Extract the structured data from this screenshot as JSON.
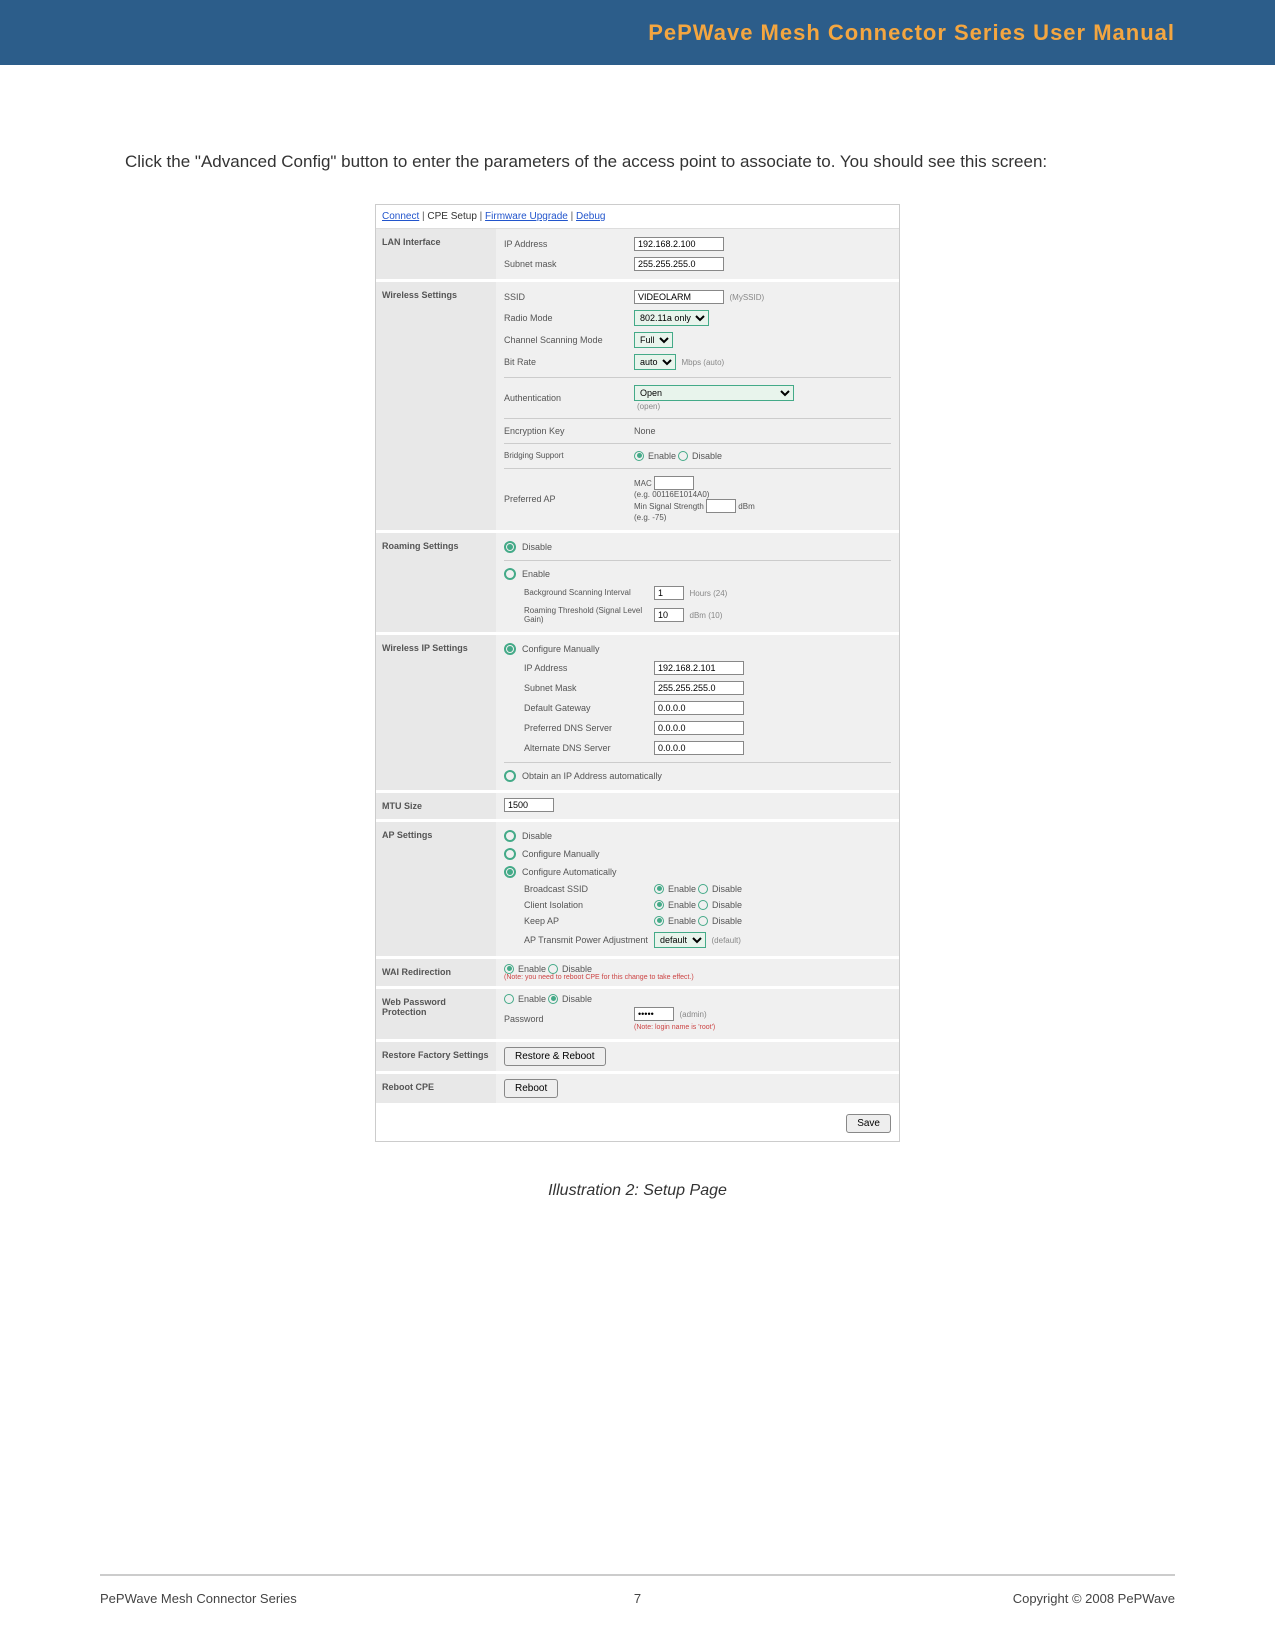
{
  "header": {
    "title": "PePWave Mesh Connector Series User Manual"
  },
  "intro": "Click the \"Advanced Config\" button to enter the parameters of the access point to associate to.  You should see this screen:",
  "nav": {
    "connect": "Connect",
    "cpe": "CPE Setup",
    "firmware": "Firmware Upgrade",
    "debug": "Debug"
  },
  "lan": {
    "title": "LAN Interface",
    "ip_label": "IP Address",
    "ip": "192.168.2.100",
    "mask_label": "Subnet mask",
    "mask": "255.255.255.0"
  },
  "wireless": {
    "title": "Wireless Settings",
    "ssid_label": "SSID",
    "ssid": "VIDEOLARM",
    "ssid_note": "(MySSID)",
    "radio_label": "Radio Mode",
    "radio": "802.11a only",
    "scan_label": "Channel Scanning Mode",
    "scan": "Full",
    "bitrate_label": "Bit Rate",
    "bitrate": "auto",
    "bitrate_note": "Mbps (auto)",
    "auth_label": "Authentication",
    "auth": "Open",
    "auth_note": "(open)",
    "enc_label": "Encryption Key",
    "enc": "None",
    "bridge_label": "Bridging Support",
    "enable": "Enable",
    "disable": "Disable",
    "pref_label": "Preferred AP",
    "mac": "MAC",
    "mac_eg": "(e.g. 00116E1014A0)",
    "min_sig": "Min Signal Strength",
    "dbm": "dBm",
    "dbm_eg": "(e.g. -75)"
  },
  "roaming": {
    "title": "Roaming Settings",
    "disable": "Disable",
    "enable": "Enable",
    "bg_label": "Background Scanning Interval",
    "bg_val": "1",
    "bg_note": "Hours (24)",
    "thr_label": "Roaming Threshold (Signal Level Gain)",
    "thr_val": "10",
    "thr_note": "dBm (10)"
  },
  "wip": {
    "title": "Wireless IP Settings",
    "configure": "Configure Manually",
    "ip_label": "IP Address",
    "ip": "192.168.2.101",
    "mask_label": "Subnet Mask",
    "mask": "255.255.255.0",
    "gw_label": "Default Gateway",
    "gw": "0.0.0.0",
    "dns1_label": "Preferred DNS Server",
    "dns1": "0.0.0.0",
    "dns2_label": "Alternate DNS Server",
    "dns2": "0.0.0.0",
    "auto": "Obtain an IP Address automatically"
  },
  "mtu": {
    "title": "MTU Size",
    "val": "1500"
  },
  "ap": {
    "title": "AP Settings",
    "disable": "Disable",
    "manual": "Configure Manually",
    "auto": "Configure Automatically",
    "bssid_label": "Broadcast SSID",
    "iso_label": "Client Isolation",
    "keep_label": "Keep AP",
    "tx_label": "AP Transmit Power Adjustment",
    "tx": "default",
    "tx_note": "(default)",
    "enable": "Enable",
    "disable2": "Disable"
  },
  "wai": {
    "title": "WAI Redirection",
    "enable": "Enable",
    "disable": "Disable",
    "note": "(Note: you need to reboot CPE for this change to take effect.)"
  },
  "webpw": {
    "title": "Web Password Protection",
    "enable": "Enable",
    "disable": "Disable",
    "pw_label": "Password",
    "pw_note": "(admin)",
    "note2": "(Note: login name is 'root')"
  },
  "restore": {
    "title": "Restore Factory Settings",
    "btn": "Restore & Reboot"
  },
  "reboot": {
    "title": "Reboot CPE",
    "btn": "Reboot"
  },
  "save": "Save",
  "caption": "Illustration 2: Setup Page",
  "footer": {
    "left": "PePWave  Mesh Connector Series",
    "page": "7",
    "right": "Copyright © 2008 PePWave"
  }
}
